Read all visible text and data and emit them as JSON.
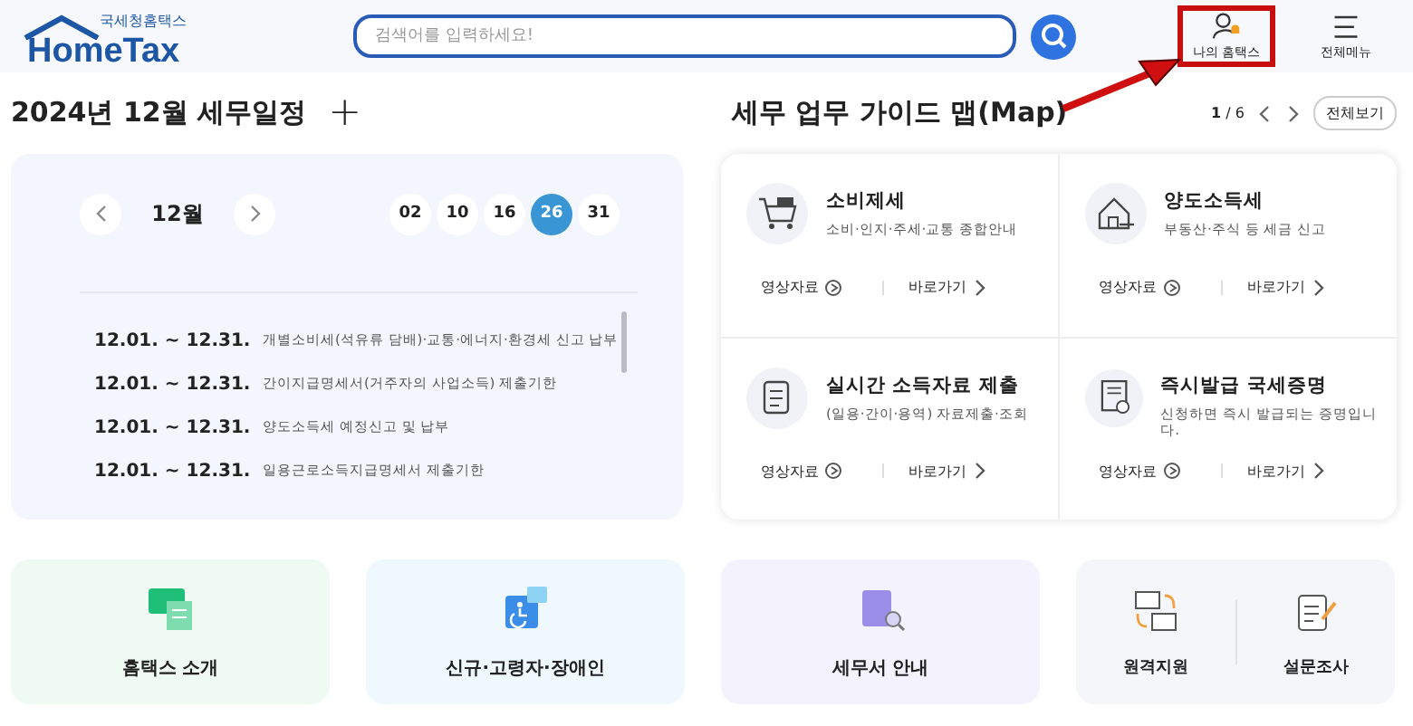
{
  "header": {
    "logo": {
      "tagline": "국세청홈택스",
      "name": "HomeTax"
    },
    "search": {
      "placeholder": "검색어를 입력하세요!"
    },
    "actions": [
      {
        "kind": "user",
        "label": "나의 홈택스",
        "highlighted": true
      },
      {
        "kind": "menu",
        "label": "전체메뉴",
        "highlighted": false
      }
    ]
  },
  "schedule": {
    "title": "2024년 12월 세무일정",
    "add": "+",
    "month": "12월",
    "dates": [
      {
        "label": "02",
        "selected": false
      },
      {
        "label": "10",
        "selected": false
      },
      {
        "label": "16",
        "selected": false
      },
      {
        "label": "26",
        "selected": true
      },
      {
        "label": "31",
        "selected": false
      }
    ],
    "events": [
      {
        "period": "12.01. ~ 12.31.",
        "text": "개별소비세(석유류 담배)·교통·에너지·환경세 신고 납부"
      },
      {
        "period": "12.01. ~ 12.31.",
        "text": "간이지급명세서(거주자의 사업소득) 제출기한"
      },
      {
        "period": "12.01. ~ 12.31.",
        "text": "양도소득세 예정신고 및 납부"
      },
      {
        "period": "12.01. ~ 12.31.",
        "text": "일용근로소득지급명세서 제출기한"
      }
    ]
  },
  "guide": {
    "title": "세무 업무 가이드 맵(Map)",
    "page": "1",
    "pages": "/ 6",
    "view_all": "전체보기",
    "cards": [
      {
        "kind": "cart",
        "title": "소비제세",
        "desc": "소비·인지·주세·교통 종합안내",
        "video": "영상자료",
        "go": "바로가기"
      },
      {
        "kind": "house",
        "title": "양도소득세",
        "desc": "부동산·주식 등 세금 신고",
        "video": "영상자료",
        "go": "바로가기"
      },
      {
        "kind": "clipboard",
        "title": "실시간 소득자료 제출",
        "desc": "(일용·간이·용역) 자료제출·조회",
        "video": "영상자료",
        "go": "바로가기"
      },
      {
        "kind": "certificate",
        "title": "즉시발급 국세증명",
        "desc": "신청하면 즉시 발급되는 증명입니다.",
        "video": "영상자료",
        "go": "바로가기"
      }
    ]
  },
  "shortcuts": [
    {
      "kind": "tax",
      "label": "홈택스 소개"
    },
    {
      "kind": "accessible",
      "label": "신규·고령자·장애인"
    },
    {
      "kind": "office",
      "label": "세무서 안내"
    },
    {
      "kind": "pair",
      "items": [
        {
          "kind": "remote",
          "label": "원격지원"
        },
        {
          "kind": "survey",
          "label": "설문조사"
        }
      ]
    }
  ]
}
